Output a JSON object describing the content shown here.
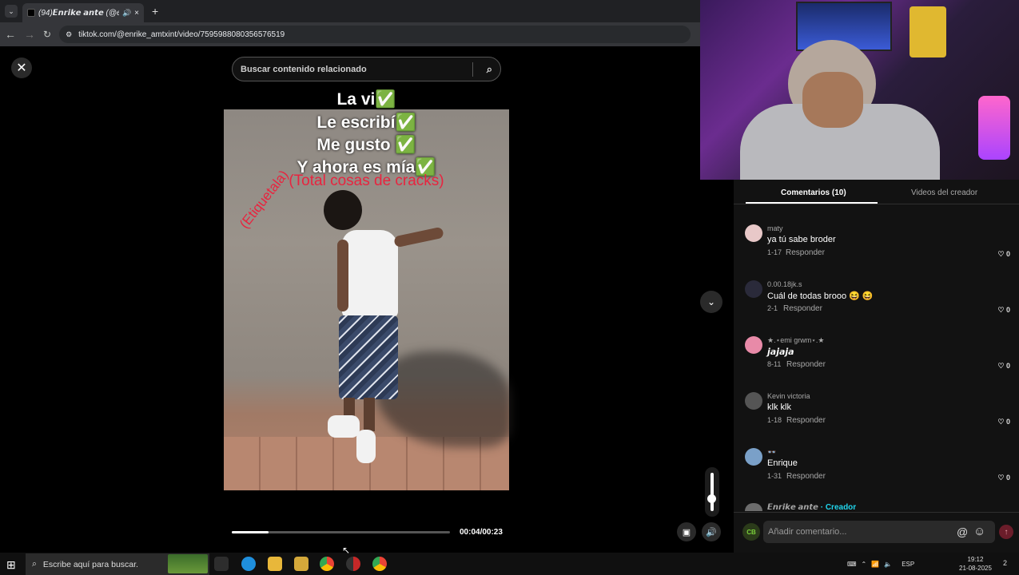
{
  "browser": {
    "tab_title": "(94)𝙀𝙣𝙧𝙞𝙠𝙚 𝙖𝙣𝙩𝙚 (@enrik",
    "tab_close": "×",
    "new_tab": "+",
    "url": "tiktok.com/@enrike_amtxint/video/7595988080356576519"
  },
  "video": {
    "search_placeholder": "Buscar contenido relacionado",
    "captions": [
      "La vi✅",
      "Le escribí✅",
      "Me gusto ✅",
      "Y ahora es mía✅"
    ],
    "caption_red": "(Total cosas de cracks)",
    "caption_tag": "(Etiquetala)",
    "progress": 0.17,
    "timecode": "00:04/00:23"
  },
  "panel": {
    "tab_comments": "Comentarios (10)",
    "tab_creator": "Videos del creador",
    "reply_label": "Responder",
    "comments": [
      {
        "user": "maty",
        "text": "ya tú sabe broder",
        "date": "1-17",
        "likes": "0",
        "avatar_color": "#e8c8c8"
      },
      {
        "user": "0.00.18jk.s",
        "text": "Cuál de todas brooo 😆 😆",
        "date": "2-1",
        "likes": "0",
        "avatar_color": "#2a2a3a"
      },
      {
        "user": "★.⋆emi grwm⋆.★",
        "text": "𝙟𝙖𝙟𝙖𝙟𝙖",
        "date": "8-11",
        "likes": "0",
        "avatar_color": "#e88aa8"
      },
      {
        "user": "Kevin victoria",
        "text": "klk klk",
        "date": "1-18",
        "likes": "0",
        "avatar_color": "#555"
      },
      {
        "user": "👓",
        "text": "Enrique",
        "date": "1-31",
        "likes": "0",
        "avatar_color": "#7aa0c8"
      }
    ],
    "last_user": "𝙀𝙣𝙧𝙞𝙠𝙚 𝙖𝙣𝙩𝙚",
    "creator_badge": " · Creador",
    "comment_placeholder": "Añadir comentario...",
    "me_avatar": "CB"
  },
  "taskbar": {
    "search_text": "Escribe aquí para buscar.",
    "lang": "ESP",
    "time": "19:12",
    "date": "21-08-2025",
    "notifications": "2"
  },
  "icons": {
    "search": "🔍",
    "close": "✕",
    "chevron": "⌄",
    "heart": "♡"
  }
}
